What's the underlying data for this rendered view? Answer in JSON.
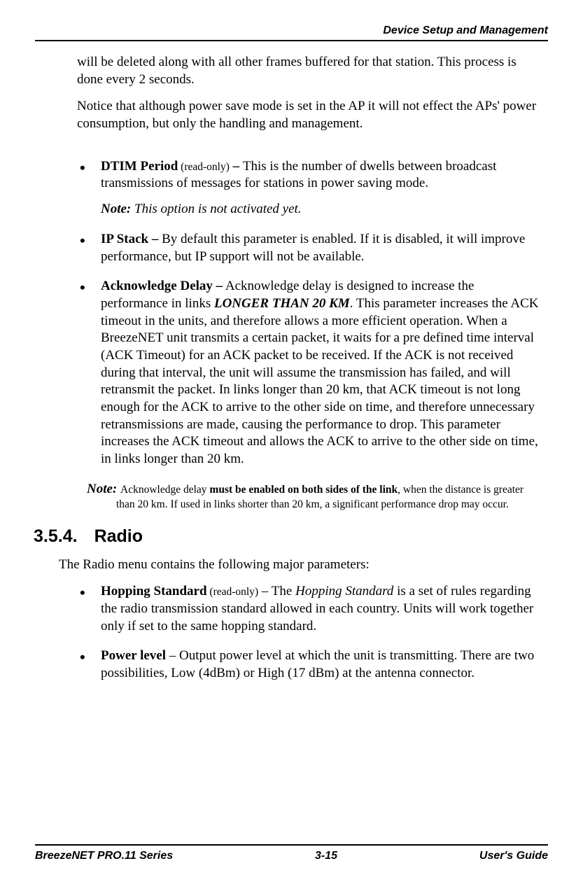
{
  "header": {
    "title": "Device Setup and Management"
  },
  "intro": {
    "para1": "will be deleted along with all other frames buffered for that station. This process is done every 2 seconds.",
    "para2": "Notice that although power save mode is set in the AP it will not effect the APs' power consumption, but only the handling and management."
  },
  "items": {
    "dtim": {
      "label": "DTIM Period",
      "suffix": " (read-only)",
      "sep": " – ",
      "text": "This is the number of dwells between broadcast transmissions of messages for stations in power saving mode.",
      "note_lead": "Note:",
      "note_text": " This option is not activated yet."
    },
    "ip": {
      "label": "IP Stack –",
      "text": " By default this parameter is enabled. If it is disabled, it will improve performance, but IP support will not be available."
    },
    "ack": {
      "label": "Acknowledge Delay –",
      "text1": " Acknowledge delay is designed to increase the performance in links ",
      "emph": "LONGER THAN 20 KM",
      "text2": ". This parameter increases the ACK timeout in the units, and therefore allows a more efficient operation. When a BreezeNET unit transmits a certain packet, it waits for a pre defined time interval (ACK Timeout) for an ACK packet to be received. If the ACK is not received during that interval, the unit will assume the transmission has failed, and will retransmit the packet. In links longer than 20 km, that ACK timeout is not long enough for the ACK to arrive to the other side on time, and therefore unnecessary retransmissions are made, causing the performance to drop. This parameter increases the ACK timeout and allows the ACK to arrive to the other side on time, in links longer than 20 km."
    }
  },
  "ack_note": {
    "lead": "Note: ",
    "t1": "Acknowledge delay ",
    "bold": "must be enabled on both sides of the link",
    "t2": ", when the distance is greater than 20 km. If used in links shorter than 20 km, a significant performance drop may occur."
  },
  "section": {
    "number": "3.5.4.",
    "title": "Radio",
    "intro": "The Radio menu contains the following major parameters:",
    "hopping": {
      "label": "Hopping Standard",
      "suffix": " (read-only)",
      "sep": " – The ",
      "ital": "Hopping Standard",
      "text": " is a set of rules regarding the radio transmission standard allowed in each country. Units will work together only if set to the same hopping standard."
    },
    "power": {
      "label": "Power level",
      "sep": " – ",
      "text": "Output power level at which the unit is transmitting. There are two possibilities, Low (4dBm) or High (17 dBm) at the antenna connector."
    }
  },
  "footer": {
    "left": "BreezeNET PRO.11 Series",
    "center": "3-15",
    "right": "User's Guide"
  }
}
